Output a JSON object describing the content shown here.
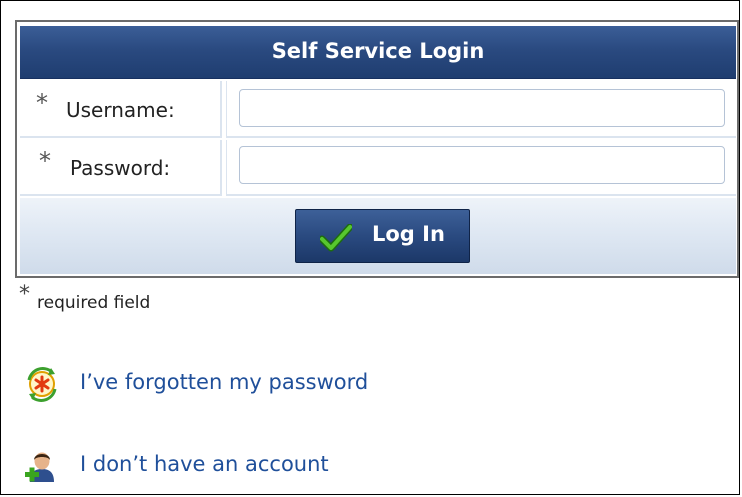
{
  "login": {
    "title": "Self Service Login",
    "username": {
      "label": "Username:",
      "required_marker": "*",
      "value": "",
      "placeholder": ""
    },
    "password": {
      "label": "Password:",
      "required_marker": "*",
      "value": "",
      "placeholder": ""
    },
    "submit_label": "Log In"
  },
  "legend": {
    "required_marker": "*",
    "required_text": "required field"
  },
  "links": {
    "forgot_password": "I’ve forgotten my password",
    "no_account": "I don’t have an account"
  },
  "icons": {
    "submit": "check-icon",
    "forgot_password": "password-reset-icon",
    "no_account": "add-user-icon"
  },
  "colors": {
    "header": "#2a4a80",
    "button": "#2a4a80",
    "link": "#1f4f9a",
    "action_bar": "#dfe8f3",
    "check": "#3aa51f"
  }
}
